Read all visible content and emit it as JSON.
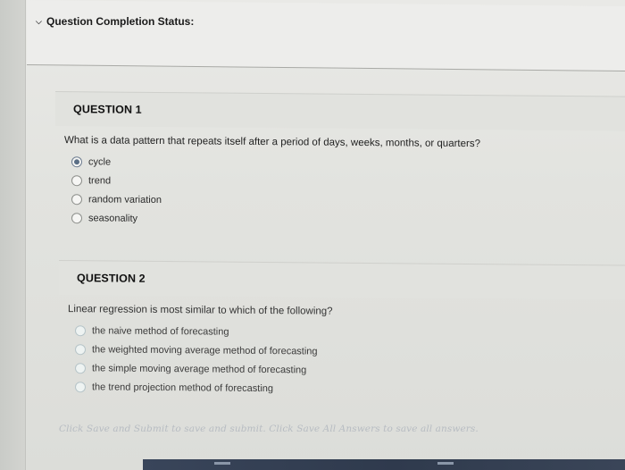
{
  "status": {
    "label": "Question Completion Status:",
    "icon": "chevron-down-icon"
  },
  "questions": [
    {
      "title": "QUESTION 1",
      "text": "What is a data pattern that repeats itself after a period of days, weeks, months, or quarters?",
      "options": [
        {
          "label": "cycle",
          "selected": true
        },
        {
          "label": "trend",
          "selected": false
        },
        {
          "label": "random variation",
          "selected": false
        },
        {
          "label": "seasonality",
          "selected": false
        }
      ]
    },
    {
      "title": "QUESTION 2",
      "text": "Linear regression is most similar to which of the following?",
      "options": [
        {
          "label": "the naive method of forecasting",
          "selected": false
        },
        {
          "label": "the weighted moving average method of forecasting",
          "selected": false
        },
        {
          "label": "the simple moving average method of forecasting",
          "selected": false
        },
        {
          "label": "the trend projection method of forecasting",
          "selected": false
        }
      ]
    }
  ],
  "footer": {
    "hint": "Click Save and Submit to save and submit. Click Save All Answers to save all answers."
  },
  "colors": {
    "selected_radio": "#5b6f86",
    "footer_text": "#b7bcc2"
  }
}
